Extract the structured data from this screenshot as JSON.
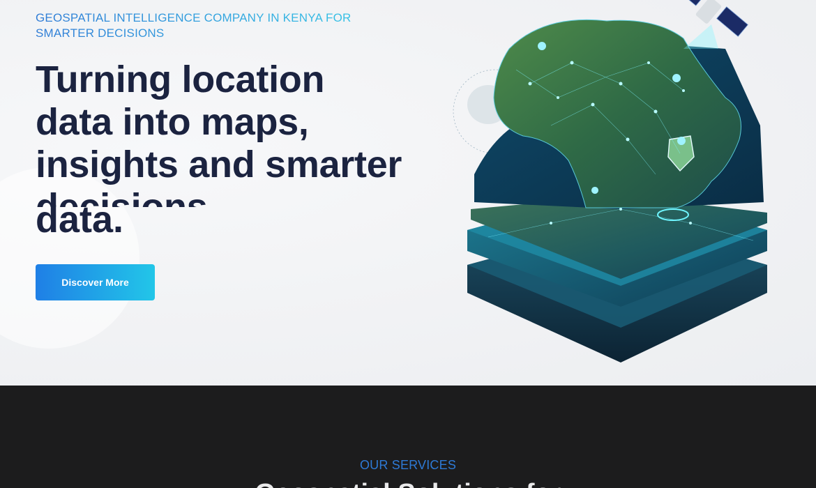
{
  "hero": {
    "eyebrow": [
      "GEOSPATIAL INTELLIGENCE COMPANY IN KENYA FOR",
      "SMARTER DECISIONS"
    ],
    "headline": [
      "Turning location",
      "data into maps,",
      "insights and smarter",
      "decisions"
    ],
    "headline_overlap": "data.",
    "cta_label": "Discover More",
    "colors": {
      "heading": "#1b2340",
      "accent_start": "#1f7fe6",
      "accent_end": "#22c6e8"
    }
  },
  "illustration": {
    "icon": "africa-layered-map-illustration"
  },
  "services": {
    "label": "OUR SERVICES",
    "heading": "Geospatial Solutions for",
    "colors": {
      "background": "#1c1c1d",
      "label": "#2e7ad6"
    }
  }
}
